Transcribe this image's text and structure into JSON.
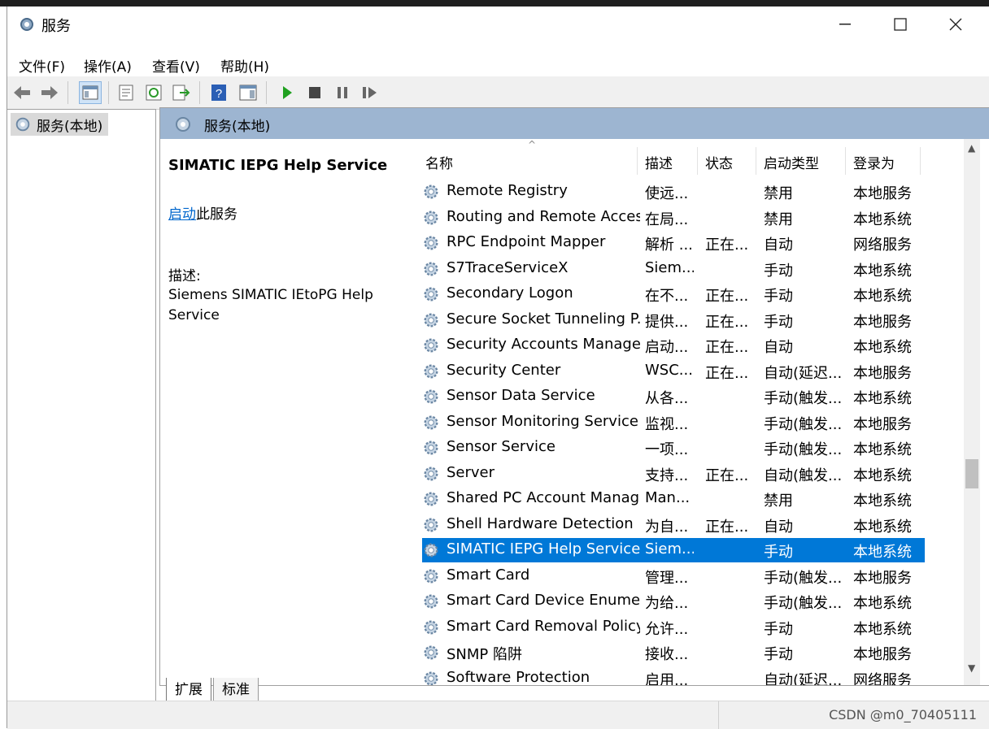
{
  "window": {
    "title": "服务"
  },
  "menu": [
    "文件(F)",
    "操作(A)",
    "查看(V)",
    "帮助(H)"
  ],
  "tree": {
    "root_label": "服务(本地)"
  },
  "header": {
    "title": "服务(本地)"
  },
  "detail": {
    "service_name": "SIMATIC IEPG Help Service",
    "start_link": "启动",
    "start_suffix": "此服务",
    "desc_label": "描述:",
    "desc_text": "Siemens SIMATIC IEtoPG Help Service"
  },
  "columns": [
    "名称",
    "描述",
    "状态",
    "启动类型",
    "登录为"
  ],
  "rows": [
    {
      "name": "Remote Registry",
      "desc": "使远...",
      "status": "",
      "startup": "禁用",
      "logon": "本地服务"
    },
    {
      "name": "Routing and Remote Access",
      "desc": "在局...",
      "status": "",
      "startup": "禁用",
      "logon": "本地系统"
    },
    {
      "name": "RPC Endpoint Mapper",
      "desc": "解析 ...",
      "status": "正在...",
      "startup": "自动",
      "logon": "网络服务"
    },
    {
      "name": "S7TraceServiceX",
      "desc": "Siem...",
      "status": "",
      "startup": "手动",
      "logon": "本地系统"
    },
    {
      "name": "Secondary Logon",
      "desc": "在不...",
      "status": "正在...",
      "startup": "手动",
      "logon": "本地系统"
    },
    {
      "name": "Secure Socket Tunneling P...",
      "desc": "提供...",
      "status": "正在...",
      "startup": "手动",
      "logon": "本地服务"
    },
    {
      "name": "Security Accounts Manager",
      "desc": "启动...",
      "status": "正在...",
      "startup": "自动",
      "logon": "本地系统"
    },
    {
      "name": "Security Center",
      "desc": "WSC...",
      "status": "正在...",
      "startup": "自动(延迟...",
      "logon": "本地服务"
    },
    {
      "name": "Sensor Data Service",
      "desc": "从各...",
      "status": "",
      "startup": "手动(触发...",
      "logon": "本地系统"
    },
    {
      "name": "Sensor Monitoring Service",
      "desc": "监视...",
      "status": "",
      "startup": "手动(触发...",
      "logon": "本地服务"
    },
    {
      "name": "Sensor Service",
      "desc": "一项...",
      "status": "",
      "startup": "手动(触发...",
      "logon": "本地系统"
    },
    {
      "name": "Server",
      "desc": "支持...",
      "status": "正在...",
      "startup": "自动(触发...",
      "logon": "本地系统"
    },
    {
      "name": "Shared PC Account Manager",
      "desc": "Man...",
      "status": "",
      "startup": "禁用",
      "logon": "本地系统"
    },
    {
      "name": "Shell Hardware Detection",
      "desc": "为自...",
      "status": "正在...",
      "startup": "自动",
      "logon": "本地系统"
    },
    {
      "name": "SIMATIC IEPG Help Service",
      "desc": "Siem...",
      "status": "",
      "startup": "手动",
      "logon": "本地系统",
      "selected": true
    },
    {
      "name": "Smart Card",
      "desc": "管理...",
      "status": "",
      "startup": "手动(触发...",
      "logon": "本地服务"
    },
    {
      "name": "Smart Card Device Enumer...",
      "desc": "为给...",
      "status": "",
      "startup": "手动(触发...",
      "logon": "本地系统"
    },
    {
      "name": "Smart Card Removal Policy",
      "desc": "允许...",
      "status": "",
      "startup": "手动",
      "logon": "本地系统"
    },
    {
      "name": "SNMP 陷阱",
      "desc": "接收...",
      "status": "",
      "startup": "手动",
      "logon": "本地服务"
    },
    {
      "name": "Software Protection",
      "desc": "启用...",
      "status": "",
      "startup": "自动(延迟...",
      "logon": "网络服务"
    }
  ],
  "tabs": [
    "扩展",
    "标准"
  ],
  "watermark": "CSDN @m0_70405111",
  "colors": {
    "selection": "#0078d7",
    "header_bar": "#9db5d1",
    "link": "#0066cc"
  }
}
